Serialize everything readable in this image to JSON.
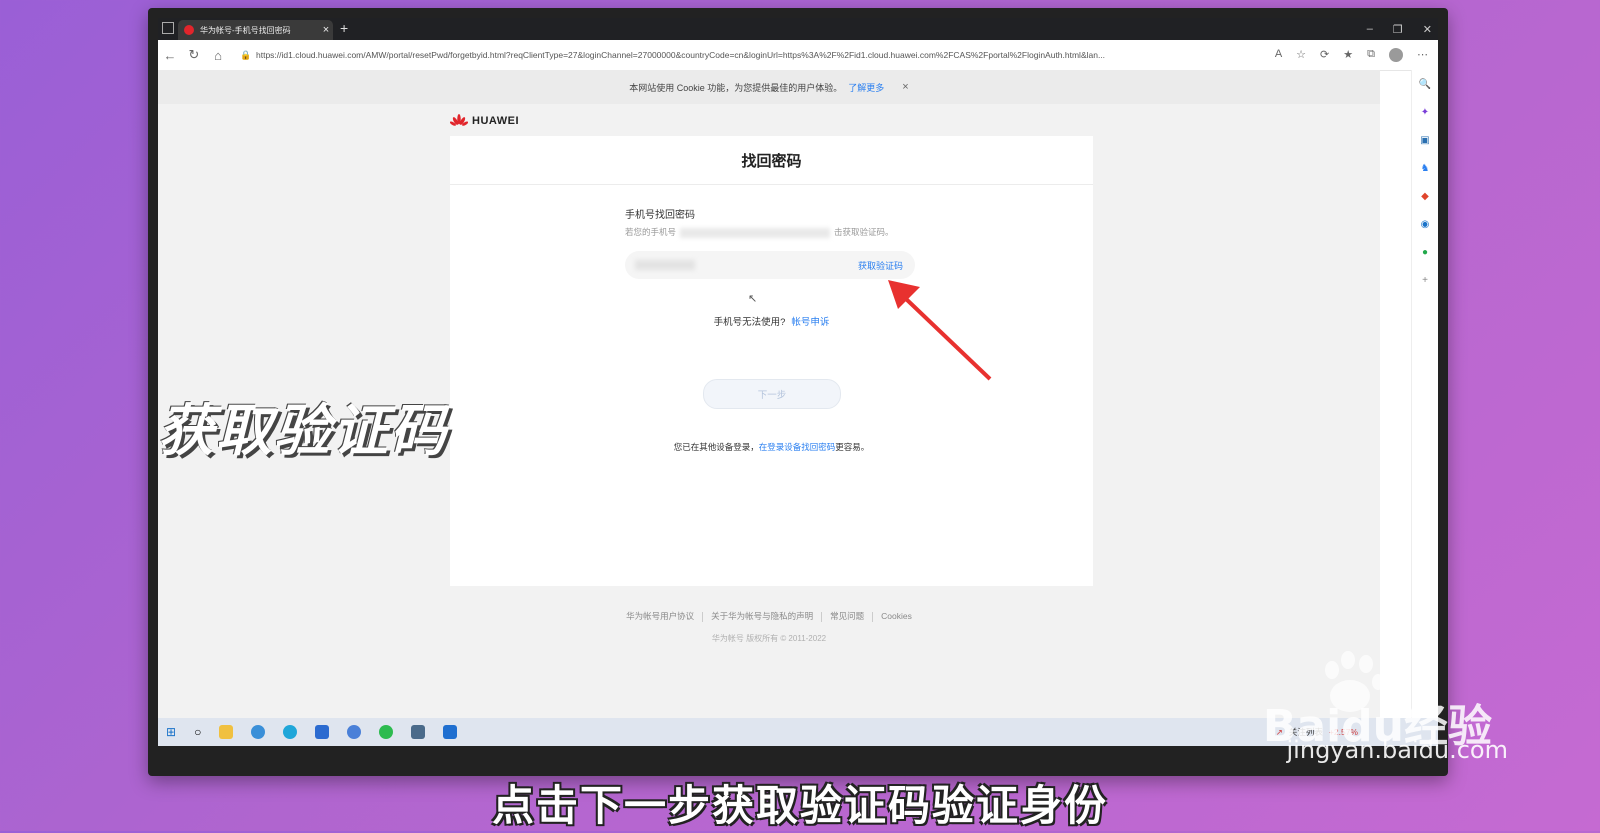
{
  "browser": {
    "tab_title": "华为帐号-手机号找回密码",
    "url": "https://id1.cloud.huawei.com/AMW/portal/resetPwd/forgetbyid.html?reqClientType=27&loginChannel=27000000&countryCode=cn&loginUrl=https%3A%2F%2Fid1.cloud.huawei.com%2FCAS%2Fportal%2FloginAuth.html&lan...",
    "new_tab": "+"
  },
  "cookie_banner": {
    "text": "本网站使用 Cookie 功能，为您提供最佳的用户体验。",
    "link": "了解更多",
    "close": "×"
  },
  "brand": {
    "name": "HUAWEI",
    "color": "#e1252b"
  },
  "page": {
    "title": "找回密码",
    "section_title": "手机号找回密码",
    "desc_prefix": "若您的手机号",
    "desc_suffix": "击获取验证码。",
    "get_code": "获取验证码",
    "cannot_use": "手机号无法使用?",
    "appeal": "帐号申诉",
    "next": "下一步",
    "other_device_prefix": "您已在其他设备登录，",
    "other_device_link": "在登录设备找回密码",
    "other_device_suffix": "更容易。"
  },
  "footer": {
    "links": [
      "华为帐号用户协议",
      "关于华为帐号与隐私的声明",
      "常见问题",
      "Cookies"
    ],
    "copyright": "华为帐号 版权所有 © 2011-2022"
  },
  "taskbar": {
    "tray_label": "关注列表",
    "tray_value": "+2.57%"
  },
  "overlay": {
    "title": "获取验证码",
    "subtitle": "点击下一步获取验证码验证身份"
  },
  "watermark": {
    "brand": "Baidu经验",
    "url": "jingyan.baidu.com"
  },
  "colors": {
    "accent": "#2a7ff0",
    "arrow": "#e8312f"
  }
}
